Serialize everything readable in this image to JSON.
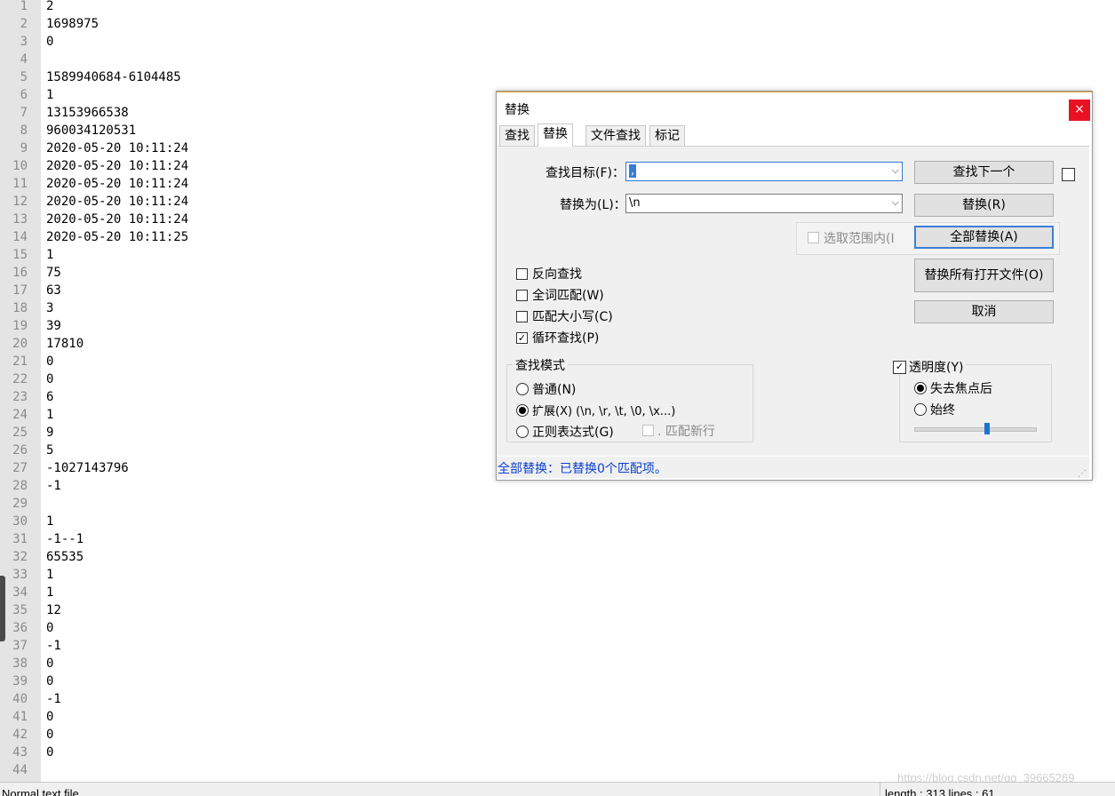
{
  "editor": {
    "lines": [
      {
        "n": "1",
        "t": "2"
      },
      {
        "n": "2",
        "t": "1698975"
      },
      {
        "n": "3",
        "t": "0"
      },
      {
        "n": "4",
        "t": ""
      },
      {
        "n": "5",
        "t": "1589940684-6104485"
      },
      {
        "n": "6",
        "t": "1"
      },
      {
        "n": "7",
        "t": "13153966538"
      },
      {
        "n": "8",
        "t": "960034120531"
      },
      {
        "n": "9",
        "t": "2020-05-20 10:11:24"
      },
      {
        "n": "10",
        "t": "2020-05-20 10:11:24"
      },
      {
        "n": "11",
        "t": "2020-05-20 10:11:24"
      },
      {
        "n": "12",
        "t": "2020-05-20 10:11:24"
      },
      {
        "n": "13",
        "t": "2020-05-20 10:11:24"
      },
      {
        "n": "14",
        "t": "2020-05-20 10:11:25"
      },
      {
        "n": "15",
        "t": "1"
      },
      {
        "n": "16",
        "t": "75"
      },
      {
        "n": "17",
        "t": "63"
      },
      {
        "n": "18",
        "t": "3"
      },
      {
        "n": "19",
        "t": "39"
      },
      {
        "n": "20",
        "t": "17810"
      },
      {
        "n": "21",
        "t": "0"
      },
      {
        "n": "22",
        "t": "0"
      },
      {
        "n": "23",
        "t": "6"
      },
      {
        "n": "24",
        "t": "1"
      },
      {
        "n": "25",
        "t": "9"
      },
      {
        "n": "26",
        "t": "5"
      },
      {
        "n": "27",
        "t": "-1027143796"
      },
      {
        "n": "28",
        "t": "-1"
      },
      {
        "n": "29",
        "t": ""
      },
      {
        "n": "30",
        "t": "1"
      },
      {
        "n": "31",
        "t": "-1--1"
      },
      {
        "n": "32",
        "t": "65535"
      },
      {
        "n": "33",
        "t": "1"
      },
      {
        "n": "34",
        "t": "1"
      },
      {
        "n": "35",
        "t": "12"
      },
      {
        "n": "36",
        "t": "0"
      },
      {
        "n": "37",
        "t": "-1"
      },
      {
        "n": "38",
        "t": "0"
      },
      {
        "n": "39",
        "t": "0"
      },
      {
        "n": "40",
        "t": "-1"
      },
      {
        "n": "41",
        "t": "0"
      },
      {
        "n": "42",
        "t": "0"
      },
      {
        "n": "43",
        "t": "0"
      },
      {
        "n": "44",
        "t": ""
      }
    ]
  },
  "statusbar": {
    "left": "Normal text file",
    "right": "length : 313    lines : 61"
  },
  "watermark": "https://blog.csdn.net/qq_39665269",
  "dialog": {
    "title": "替换",
    "close_icon": "×",
    "tabs": [
      "查找",
      "替换",
      "文件查找",
      "标记"
    ],
    "active_tab": "替换",
    "find_label": "查找目标(F)：",
    "find_value": ",",
    "replace_label": "替换为(L)：",
    "replace_value": "\\n",
    "in_selection_label": "选取范围内(I",
    "buttons": {
      "find_next": "查找下一个",
      "replace": "替换(R)",
      "replace_all": "全部替换(A)",
      "replace_all_open": "替换所有打开文件(O)",
      "cancel": "取消"
    },
    "options": {
      "backward": {
        "label": "反向查找",
        "checked": false
      },
      "whole_word": {
        "label": "全词匹配(W)",
        "checked": false
      },
      "match_case": {
        "label": "匹配大小写(C)",
        "checked": false
      },
      "wrap_around": {
        "label": "循环查找(P)",
        "checked": true
      }
    },
    "search_mode": {
      "title": "查找模式",
      "normal": "普通(N)",
      "extended": "扩展(X) (\\n, \\r, \\t, \\0, \\x...)",
      "regex": "正则表达式(G)",
      "dot_newline": ". 匹配新行",
      "selected": "extended"
    },
    "transparency": {
      "title": "透明度(Y)",
      "checked": true,
      "on_lose_focus": "失去焦点后",
      "always": "始终",
      "selected": "on_lose_focus",
      "level": 0.6
    },
    "status_message": "全部替换：已替换0个匹配项。",
    "colors": {
      "status_text": "#0a3fd0",
      "close_bg": "#e81123",
      "focus": "#3c7fd6"
    }
  }
}
